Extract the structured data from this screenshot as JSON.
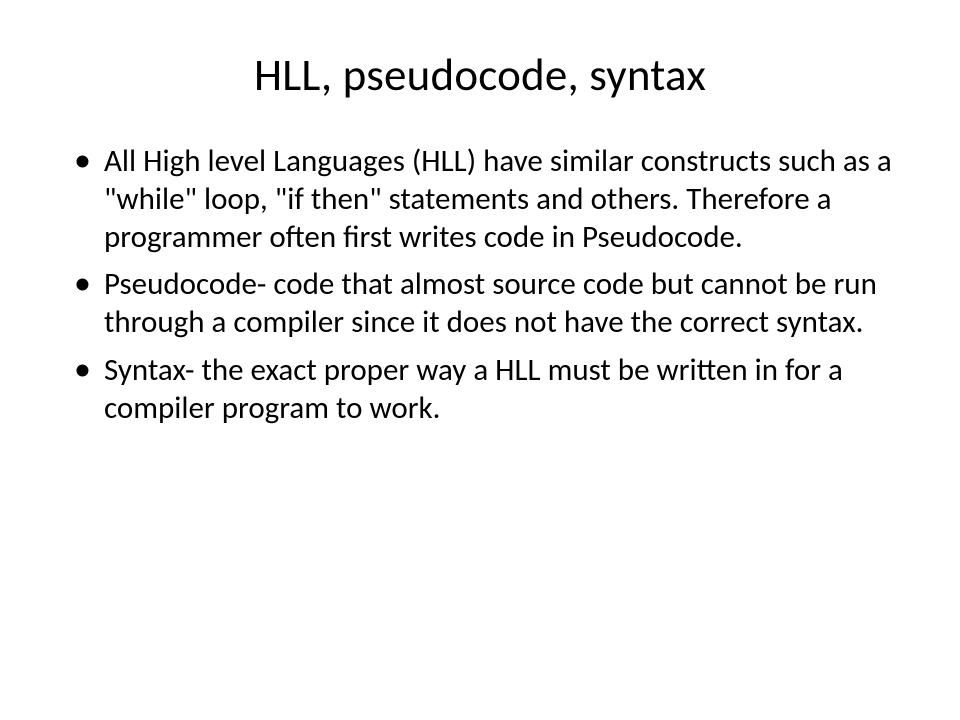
{
  "slide": {
    "title": "HLL, pseudocode, syntax",
    "bullets": [
      " All High level Languages (HLL) have similar constructs such as a \"while\" loop, \"if then\" statements and others. Therefore a programmer often first writes code in Pseudocode.",
      "Pseudocode- code that almost source code but cannot be run through a compiler since  it does not have the correct syntax.",
      "Syntax- the exact proper way a HLL must be written in for a compiler program to work."
    ]
  }
}
